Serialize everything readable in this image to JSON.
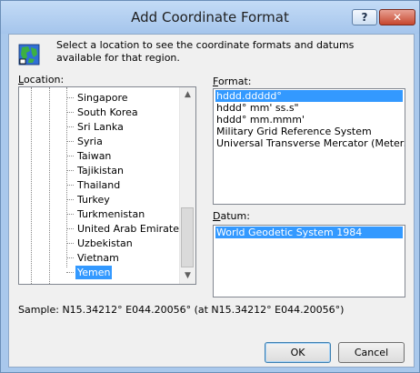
{
  "window": {
    "title": "Add Coordinate Format",
    "help_label": "?",
    "close_label": "✕"
  },
  "intro_text": "Select a location to see the coordinate formats and datums available for that region.",
  "location": {
    "label_prefix": "",
    "label_u": "L",
    "label_rest": "ocation:",
    "items": [
      "Singapore",
      "South Korea",
      "Sri Lanka",
      "Syria",
      "Taiwan",
      "Tajikistan",
      "Thailand",
      "Turkey",
      "Turkmenistan",
      "United Arab Emirates",
      "Uzbekistan",
      "Vietnam",
      "Yemen"
    ],
    "selected": "Yemen"
  },
  "format": {
    "label_u": "F",
    "label_rest": "ormat:",
    "options": [
      "hddd.ddddd°",
      "hddd° mm' ss.s\"",
      "hddd° mm.mmm'",
      "Military Grid Reference System",
      "Universal Transverse Mercator (Meters)"
    ],
    "selected": "hddd.ddddd°"
  },
  "datum": {
    "label_u": "D",
    "label_rest": "atum:",
    "options": [
      "World Geodetic System 1984"
    ],
    "selected": "World Geodetic System 1984"
  },
  "sample_text": "Sample: N15.34212°  E044.20056° (at N15.34212°  E044.20056°)",
  "buttons": {
    "ok": "OK",
    "cancel": "Cancel"
  },
  "icons": {
    "app": "globe-map-icon",
    "scroll_up": "chevron-up-icon",
    "scroll_down": "chevron-down-icon"
  }
}
